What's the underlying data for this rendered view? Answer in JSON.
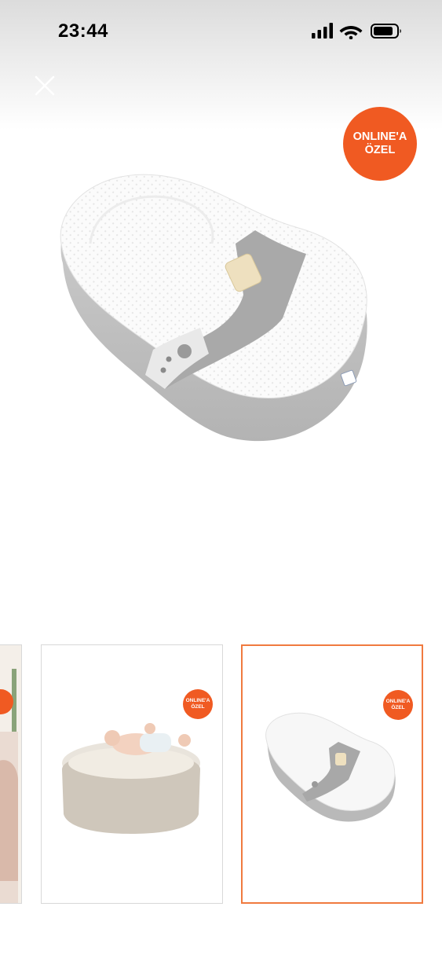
{
  "status_bar": {
    "time": "23:44",
    "icons": [
      "signal-icon",
      "wifi-icon",
      "battery-icon"
    ]
  },
  "controls": {
    "close_icon": "close-icon"
  },
  "badge": {
    "line1": "ONLINE'A",
    "line2": "ÖZEL",
    "color": "#f05a22"
  },
  "thumbnails": [
    {
      "badge_line1": "",
      "badge_line2": "",
      "selected": false
    },
    {
      "badge_line1": "ONLINE'A",
      "badge_line2": "ÖZEL",
      "selected": false
    },
    {
      "badge_line1": "ONLINE'A",
      "badge_line2": "ÖZEL",
      "selected": true
    }
  ],
  "colors": {
    "accent": "#f05a22",
    "selected_border": "#f07a3f"
  }
}
